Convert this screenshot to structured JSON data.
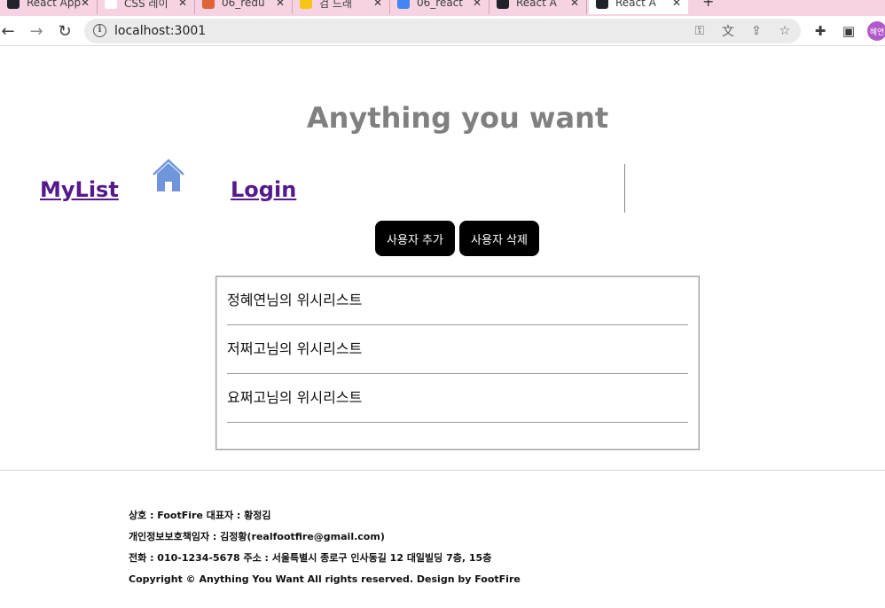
{
  "browser": {
    "tabs": [
      {
        "label": "React App",
        "favicon_color": "#20232a"
      },
      {
        "label": "CSS 레이",
        "favicon_color": "#ffffff"
      },
      {
        "label": "06_redu",
        "favicon_color": "#e0643a"
      },
      {
        "label": "검 드래",
        "favicon_color": "#f5c518"
      },
      {
        "label": "06_react",
        "favicon_color": "#4285f4"
      },
      {
        "label": "React A",
        "favicon_color": "#20232a"
      },
      {
        "label": "React A",
        "favicon_color": "#20232a"
      }
    ],
    "new_tab_label": "+",
    "url": "localhost:3001",
    "profile_label": "혜연"
  },
  "header": {
    "title": "Anything you want",
    "nav": {
      "mylist": "MyList",
      "login": "Login"
    }
  },
  "actions": {
    "add_user": "사용자 추가",
    "delete_user": "사용자 삭제"
  },
  "wishlists": [
    "정혜연님의 위시리스트",
    "저쩌고님의 위시리스트",
    "요쩌고님의 위시리스트"
  ],
  "footer": {
    "line1": "상호 : FootFire 대표자 : 황정김",
    "line2": "개인정보보호책임자 : 김정황(realfootfire@gmail.com)",
    "line3": "전화 : 010-1234-5678 주소 : 서울특별시 종로구 인사동길 12 대일빌딩 7층, 15층",
    "line4": "Copyright © Anything You Want All rights reserved. Design by FootFire"
  },
  "colors": {
    "title": "#808080",
    "link": "#551a8b",
    "home_icon": "#6f95dc",
    "button_bg": "#000000",
    "tabstrip": "#f6d3e3"
  }
}
